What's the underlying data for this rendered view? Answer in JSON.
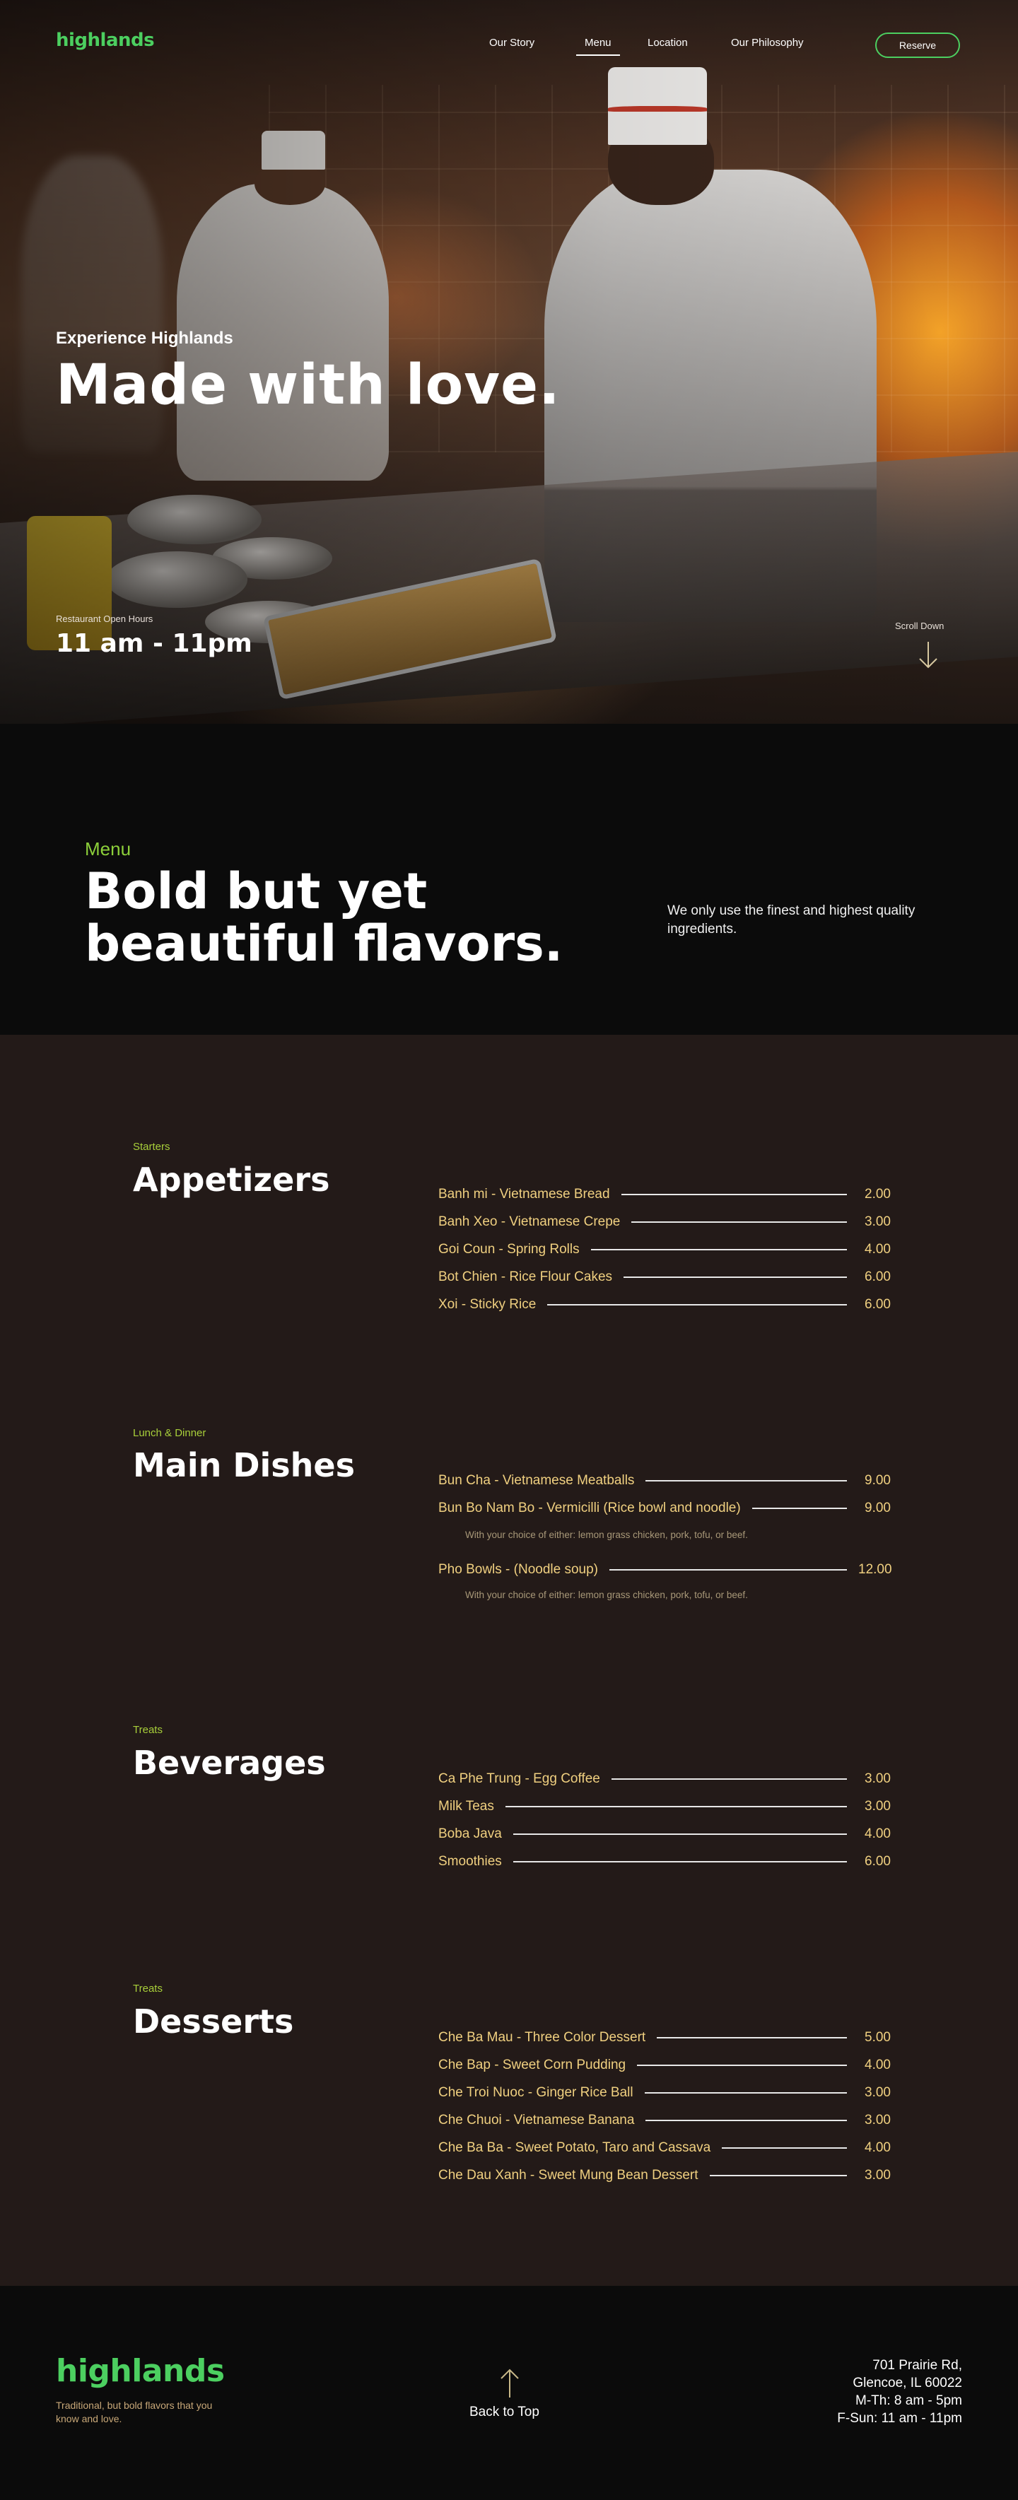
{
  "brand": {
    "name": "highlands",
    "color": "#4ccf60"
  },
  "nav": {
    "items": [
      "Our Story",
      "Menu",
      "Location",
      "Our Philosophy"
    ],
    "active": "Menu",
    "reserve_label": "Reserve"
  },
  "hero": {
    "subtitle": "Experience Highlands",
    "title": "Made with love.",
    "hours_label": "Restaurant Open Hours",
    "hours_value": "11 am - 11pm",
    "scroll_label": "Scroll Down"
  },
  "intro": {
    "eyebrow": "Menu",
    "title": "Bold but yet beautiful flavors.",
    "description": "We only use the finest and highest quality ingredients."
  },
  "menu": {
    "appetizers": {
      "eyebrow": "Starters",
      "title": "Appetizers",
      "items": [
        {
          "name": "Banh mi - Vietnamese Bread",
          "price": "2.00"
        },
        {
          "name": "Banh Xeo - Vietnamese Crepe",
          "price": "3.00"
        },
        {
          "name": "Goi Coun - Spring Rolls",
          "price": "4.00"
        },
        {
          "name": "Bot Chien - Rice Flour Cakes",
          "price": "6.00"
        },
        {
          "name": "Xoi - Sticky Rice",
          "price": "6.00"
        }
      ]
    },
    "mains": {
      "eyebrow": "Lunch & Dinner",
      "title": "Main Dishes",
      "items": [
        {
          "name": "Bun Cha - Vietnamese Meatballs",
          "price": "9.00"
        },
        {
          "name": "Bun Bo Nam Bo - Vermicilli (Rice bowl and noodle)",
          "price": "9.00",
          "note": "With your choice of either: lemon grass chicken, pork, tofu, or beef."
        },
        {
          "name": "Pho Bowls - (Noodle soup)",
          "price": "12.00",
          "note": "With your choice of either: lemon grass chicken, pork, tofu, or beef."
        }
      ]
    },
    "beverages": {
      "eyebrow": "Treats",
      "title": "Beverages",
      "items": [
        {
          "name": "Ca Phe Trung - Egg Coffee",
          "price": "3.00"
        },
        {
          "name": "Milk Teas",
          "price": "3.00"
        },
        {
          "name": "Boba Java",
          "price": "4.00"
        },
        {
          "name": "Smoothies",
          "price": "6.00"
        }
      ]
    },
    "desserts": {
      "eyebrow": "Treats",
      "title": "Desserts",
      "items": [
        {
          "name": "Che Ba Mau - Three Color Dessert",
          "price": "5.00"
        },
        {
          "name": "Che Bap - Sweet Corn Pudding",
          "price": "4.00"
        },
        {
          "name": "Che Troi Nuoc - Ginger Rice Ball",
          "price": "3.00"
        },
        {
          "name": "Che Chuoi - Vietnamese Banana",
          "price": "3.00"
        },
        {
          "name": "Che Ba Ba - Sweet Potato, Taro and Cassava",
          "price": "4.00"
        },
        {
          "name": "Che Dau Xanh - Sweet Mung Bean Dessert",
          "price": "3.00"
        }
      ]
    }
  },
  "footer": {
    "tagline": "Traditional, but bold flavors that you know and love.",
    "back_to_top": "Back to Top",
    "address_line1": "701 Prairie Rd,",
    "address_line2": "Glencoe, IL 60022",
    "hours_line1": "M-Th: 8 am - 5pm",
    "hours_line2": "F-Sun: 11 am - 11pm"
  },
  "colors": {
    "accent_green": "#4ccf60",
    "eyebrow_green": "#a8cf3a",
    "menu_item_gold": "#f0d080",
    "menu_bg": "#231a18",
    "dark_bg": "#0b0b0b"
  }
}
